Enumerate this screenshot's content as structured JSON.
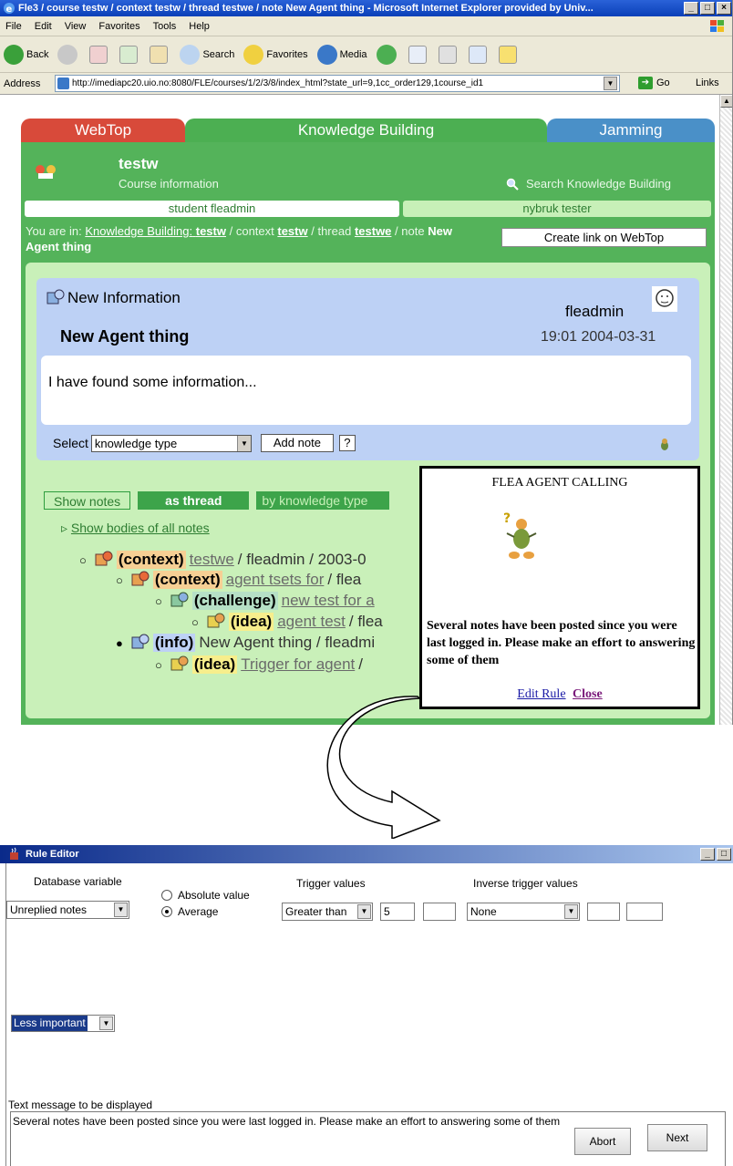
{
  "ie": {
    "title": "Fle3 / course testw / context testw / thread testwe / note New Agent thing - Microsoft Internet Explorer provided by Univ...",
    "window_buttons": [
      "_",
      "□",
      "×"
    ],
    "menu": [
      "File",
      "Edit",
      "View",
      "Favorites",
      "Tools",
      "Help"
    ],
    "toolbar": {
      "back": "Back",
      "search": "Search",
      "favorites": "Favorites",
      "media": "Media"
    },
    "address_label": "Address",
    "url": "http://imediapc20.uio.no:8080/FLE/courses/1/2/3/8/index_html?state_url=9,1cc_order129,1course_id1",
    "go": "Go",
    "links": "Links"
  },
  "tabs": {
    "webtop": "WebTop",
    "kb": "Knowledge Building",
    "jamming": "Jamming"
  },
  "course": {
    "name": "testw",
    "sub": "Course information",
    "search": "Search Knowledge Building"
  },
  "userbar": {
    "left": "student fleadmin",
    "right": "nybruk tester"
  },
  "breadcrumb": {
    "prefix": "You are in:",
    "kb_link": "Knowledge Building:",
    "kb_course": "testw",
    "context_word": "/ context",
    "context": "testw",
    "thread_word": "/ thread",
    "thread": "testwe",
    "note_word": "/ note",
    "note": "New Agent thing"
  },
  "create_link": "Create link on WebTop",
  "note": {
    "type": "New Information",
    "author": "fleadmin",
    "title": "New Agent thing",
    "time": "19:01 2004-03-31",
    "body": "I have found some information...",
    "select_label": "Select",
    "select_value": "knowledge type",
    "add_note": "Add note",
    "help": "?"
  },
  "shownotes": {
    "label": "Show notes",
    "thread": "as thread",
    "kt": "by knowledge type",
    "bodies": "Show bodies of all notes"
  },
  "tree": [
    {
      "kw": "(context)",
      "cls": "context",
      "link": "testwe",
      "rest": "/ fleadmin / 2003-0"
    },
    {
      "kw": "(context)",
      "cls": "context",
      "link": "agent tsets for",
      "rest": "/ flea"
    },
    {
      "kw": "(challenge)",
      "cls": "challenge",
      "link": "new test for a",
      "rest": ""
    },
    {
      "kw": "(idea)",
      "cls": "idea",
      "link": "agent test",
      "rest": "/ flea"
    },
    {
      "kw": "(info)",
      "cls": "info",
      "link": "",
      "rest": "New Agent thing / fleadmi"
    },
    {
      "kw": "(idea)",
      "cls": "idea",
      "link": "Trigger for agent",
      "rest": "/"
    }
  ],
  "popup": {
    "title": "FLEA AGENT CALLING",
    "message": "Several notes have been posted since you were last logged in. Please make an effort to answering some of them",
    "edit": "Edit Rule",
    "close": "Close"
  },
  "rule_editor": {
    "title": "Rule Editor",
    "db_var_label": "Database variable",
    "db_var_value": "Unreplied notes",
    "abs": "Absolute value",
    "avg": "Average",
    "trigger_label": "Trigger values",
    "trigger_op": "Greater than",
    "trigger_val": "5",
    "inverse_label": "Inverse trigger values",
    "inverse_op": "None",
    "priority": "Less important",
    "msg_label": "Text message to be displayed",
    "msg": "Several notes have been posted since you were last logged in. Please make an effort to answering some of them",
    "abort": "Abort",
    "next": "Next"
  }
}
